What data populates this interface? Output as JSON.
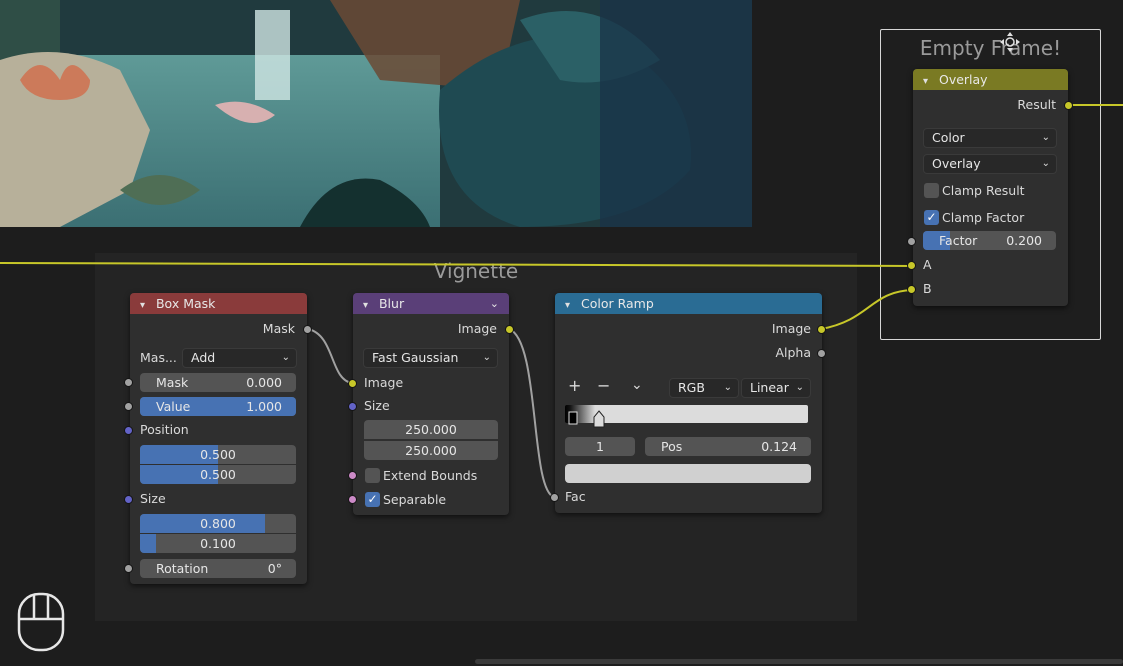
{
  "frames": {
    "vignette": "Vignette",
    "empty": "Empty Frame!"
  },
  "box_mask": {
    "title": "Box Mask",
    "header_color": "#8a3b3b",
    "output_mask": "Mask",
    "mask_type_label": "Mas...",
    "mask_type_value": "Add",
    "mask_label": "Mask",
    "mask_value": "0.000",
    "value_label": "Value",
    "value_value": "1.000",
    "position_label": "Position",
    "position_x": "0.500",
    "position_y": "0.500",
    "size_label": "Size",
    "size_x": "0.800",
    "size_y": "0.100",
    "rotation_label": "Rotation",
    "rotation_value": "0°"
  },
  "blur": {
    "title": "Blur",
    "header_color": "#5a3f78",
    "output_image": "Image",
    "filter_type": "Fast Gaussian",
    "input_image": "Image",
    "size_label": "Size",
    "size_x": "250.000",
    "size_y": "250.000",
    "extend_bounds": "Extend Bounds",
    "separable": "Separable"
  },
  "color_ramp": {
    "title": "Color Ramp",
    "header_color": "#2a6c94",
    "output_image": "Image",
    "output_alpha": "Alpha",
    "add": "+",
    "remove": "−",
    "more": "⌄",
    "color_mode": "RGB",
    "interpolation": "Linear",
    "stop_index": "1",
    "pos_label": "Pos",
    "pos_value": "0.124",
    "input_fac": "Fac"
  },
  "overlay": {
    "title": "Overlay",
    "header_color": "#7a7a23",
    "output_result": "Result",
    "data_type": "Color",
    "blend_mode": "Overlay",
    "clamp_result": "Clamp Result",
    "clamp_factor": "Clamp Factor",
    "factor_label": "Factor",
    "factor_value": "0.200",
    "input_a": "A",
    "input_b": "B"
  }
}
